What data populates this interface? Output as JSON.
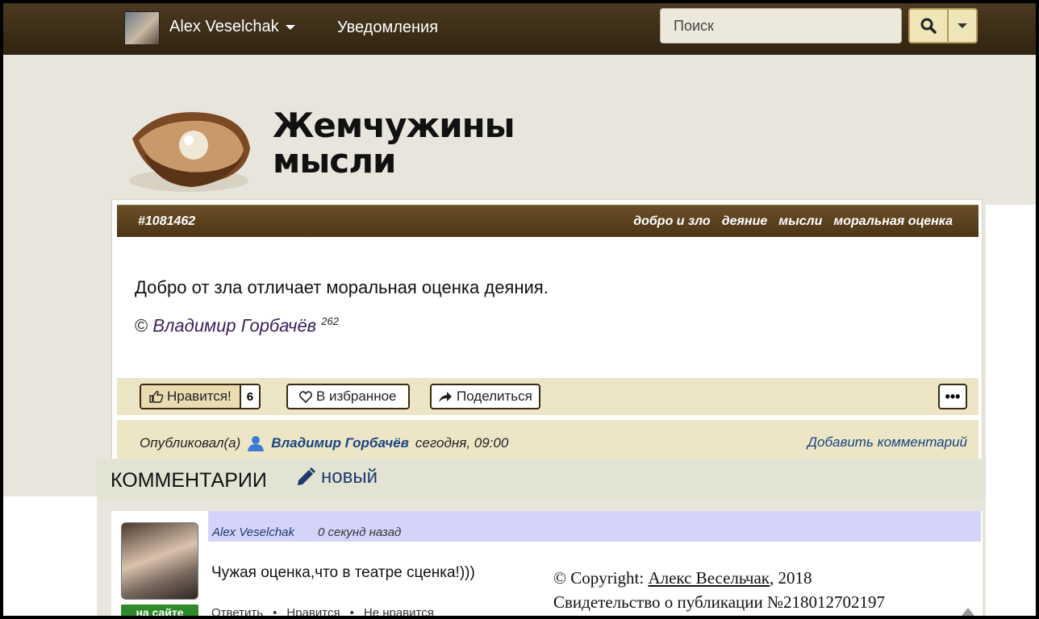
{
  "nav": {
    "user_name": "Alex Veselchak",
    "notifications_label": "Уведомления",
    "search_placeholder": "Поиск"
  },
  "site": {
    "title_line1": "Жемчужины",
    "title_line2": "мысли"
  },
  "post": {
    "id": "#1081462",
    "tags": [
      "добро и зло",
      "деяние",
      "мысли",
      "моральная оценка"
    ],
    "text": "Добро от зла отличает моральная оценка деяния.",
    "copyright_sign": "©",
    "author": "Владимир Горбачёв",
    "author_count": "262",
    "like_label": "Нравится!",
    "like_count": "6",
    "favorite_label": "В избранное",
    "share_label": "Поделиться",
    "more_label": "•••",
    "published_label": "Опубликовал(а)",
    "published_by": "Владимир Горбачёв",
    "published_time": "сегодня, 09:00",
    "add_comment_label": "Добавить комментарий"
  },
  "comments": {
    "title": "КОММЕНТАРИИ",
    "new_label": "новый",
    "items": [
      {
        "user": "Alex Veselchak",
        "time": "0 секунд назад",
        "text": "Чужая оценка,что в театре сценка!)))",
        "online_badge": "на сайте",
        "actions": [
          "Ответить",
          "Нравится",
          "Не нравится"
        ]
      }
    ]
  },
  "copyright": {
    "line1_prefix": "© Copyright: ",
    "line1_name": "Алекс Весельчак",
    "line1_suffix": ", 2018",
    "line2": "Свидетельство о публикации №218012702197"
  },
  "colors": {
    "nav_bg": "#3d2e16",
    "post_header_bg": "#5a4120",
    "action_bar_bg": "#ece6c6",
    "comment_header_bg": "#d4d4fb",
    "online_badge": "#2f8a2c",
    "link": "#1a4480"
  }
}
